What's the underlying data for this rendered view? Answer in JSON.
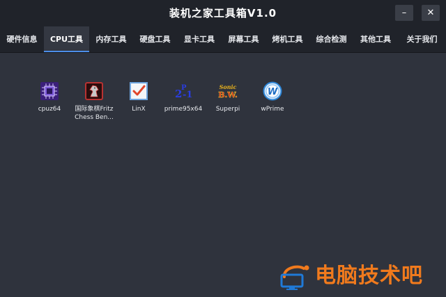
{
  "window": {
    "title": "装机之家工具箱V1.0",
    "minimize_glyph": "–",
    "close_glyph": "✕"
  },
  "tabs": [
    {
      "label": "硬件信息",
      "active": false
    },
    {
      "label": "CPU工具",
      "active": true
    },
    {
      "label": "内存工具",
      "active": false
    },
    {
      "label": "硬盘工具",
      "active": false
    },
    {
      "label": "显卡工具",
      "active": false
    },
    {
      "label": "屏幕工具",
      "active": false
    },
    {
      "label": "烤机工具",
      "active": false
    },
    {
      "label": "综合检测",
      "active": false
    },
    {
      "label": "其他工具",
      "active": false
    },
    {
      "label": "关于我们",
      "active": false
    }
  ],
  "apps": [
    {
      "label": "cpuz64",
      "icon": "cpuz-chip-icon"
    },
    {
      "label": "国际象棋Fritz Chess Ben...",
      "icon": "chess-knight-icon"
    },
    {
      "label": "LinX",
      "icon": "checkbox-icon"
    },
    {
      "label": "prime95x64",
      "icon": "prime95-formula-icon"
    },
    {
      "label": "Superpi",
      "icon": "superpi-logo-icon"
    },
    {
      "label": "wPrime",
      "icon": "wprime-globe-icon"
    }
  ],
  "icon_text": {
    "prime_base": "2",
    "prime_exp": "P",
    "prime_tail": "-1",
    "superpi_top": "Sonic",
    "superpi_bottom": "B.W.",
    "wprime_letter": "W"
  },
  "watermark": {
    "text": "电脑技术吧"
  },
  "colors": {
    "background": "#2f333d",
    "titlebar": "#20232a",
    "active_tab": "#343842",
    "watermark": "#f07a1d"
  }
}
